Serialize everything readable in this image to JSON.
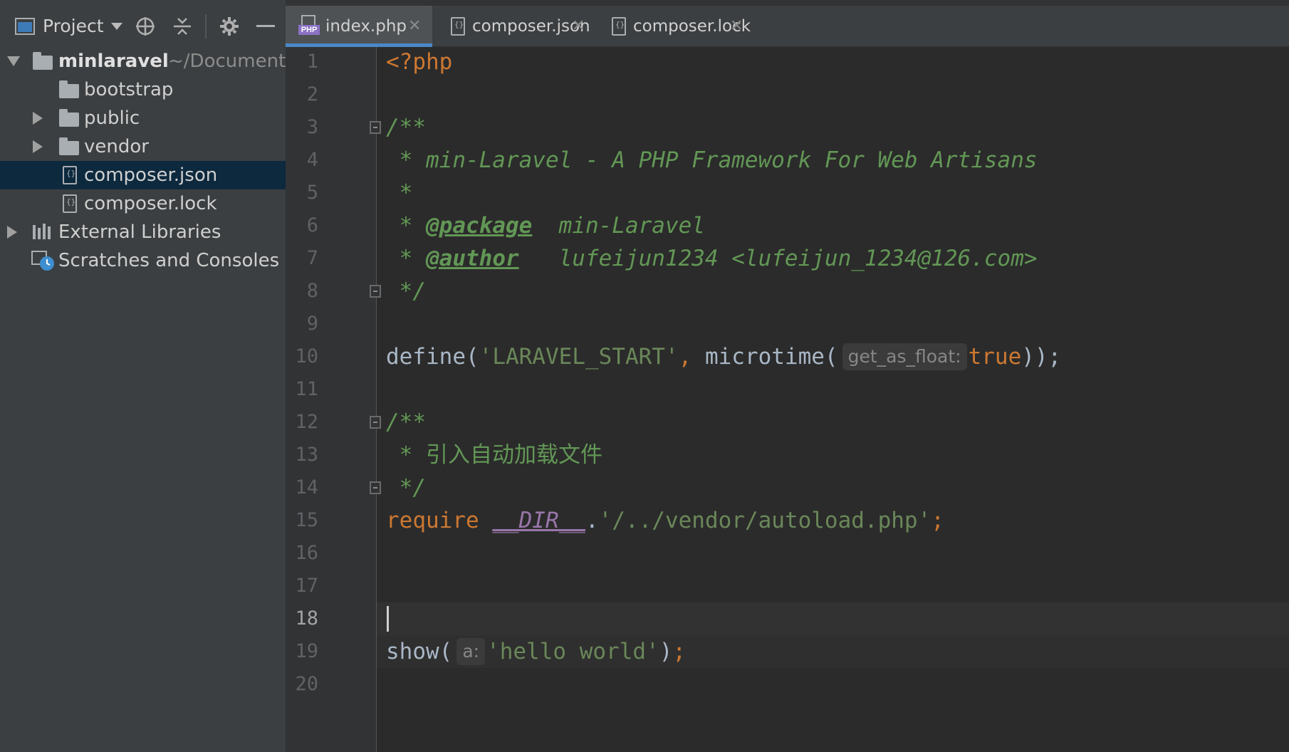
{
  "sidebar": {
    "title": "Project",
    "tree": [
      {
        "label": "minlaravel",
        "hint": "~/Documents"
      },
      {
        "label": "bootstrap"
      },
      {
        "label": "public"
      },
      {
        "label": "vendor"
      },
      {
        "label": "composer.json"
      },
      {
        "label": "composer.lock"
      },
      {
        "label": "External Libraries"
      },
      {
        "label": "Scratches and Consoles"
      }
    ]
  },
  "tabs": [
    {
      "label": "index.php",
      "active": true
    },
    {
      "label": "composer.json"
    },
    {
      "label": "composer.lock"
    }
  ],
  "editor": {
    "current_line": 18,
    "line_numbers": [
      "1",
      "2",
      "3",
      "4",
      "5",
      "6",
      "7",
      "8",
      "9",
      "10",
      "11",
      "12",
      "13",
      "14",
      "15",
      "16",
      "17",
      "18",
      "19",
      "20"
    ],
    "code": {
      "l1": "<?php",
      "l3": "/**",
      "l4": " * min-Laravel - A PHP Framework For Web Artisans",
      "l5": " *",
      "l6_prefix": " * ",
      "l6_tag": "@package",
      "l6_value": "  min-Laravel",
      "l7_prefix": " * ",
      "l7_tag": "@author",
      "l7_value": "   lufeijun1234 <lufeijun_1234@126.com>",
      "l8": " */",
      "l10_fn": "define(",
      "l10_str": "'LARAVEL_START'",
      "l10_comma": ", ",
      "l10_fn2": "microtime(",
      "l10_hint": "get_as_float:",
      "l10_kw": "true",
      "l10_end": "));",
      "l12": "/**",
      "l13_prefix": " * ",
      "l13_text": "引入自动加载文件",
      "l14": " */",
      "l15_kw": "require ",
      "l15_magic": "__DIR__",
      "l15_dot": ".",
      "l15_str": "'/../vendor/autoload.php'",
      "l15_semi": ";",
      "l19_fn": "show(",
      "l19_hint": "a:",
      "l19_str": "'hello world'",
      "l19_paren": ")",
      "l19_semi": ";"
    }
  },
  "colors": {
    "keyword": "#cc7832",
    "comment": "#629755",
    "string": "#6a8759",
    "magic": "#9876aa",
    "selection": "#0d293e",
    "tab_accent": "#4a88c7"
  }
}
